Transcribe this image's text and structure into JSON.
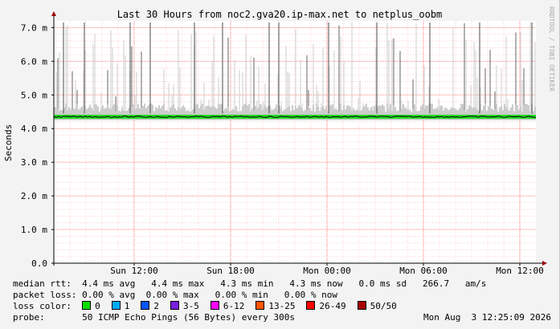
{
  "title": "Last 30 Hours from noc2.gva20.ip-max.net to netplus_oobm",
  "watermark": "RRDTOOL / TOBI OETIKER",
  "colors": {
    "median": "#000000",
    "band": "#22dd22",
    "smoke_dark": "#555555",
    "smoke_light": "#cccccc",
    "grid_major": "#ff8080",
    "grid_minor": "#ffd0d0",
    "axis": "#000000"
  },
  "chart_data": {
    "type": "area",
    "title": "Last 30 Hours from noc2.gva20.ip-max.net to netplus_oobm",
    "ylabel": "Seconds",
    "ylim": [
      0,
      7.2
    ],
    "y_unit": "ms",
    "y_ticks": [
      {
        "value": 0,
        "label": "0.0"
      },
      {
        "value": 1,
        "label": "1.0 m"
      },
      {
        "value": 2,
        "label": "2.0 m"
      },
      {
        "value": 3,
        "label": "3.0 m"
      },
      {
        "value": 4,
        "label": "4.0 m"
      },
      {
        "value": 5,
        "label": "5.0 m"
      },
      {
        "value": 6,
        "label": "6.0 m"
      },
      {
        "value": 7,
        "label": "7.0 m"
      }
    ],
    "x_range_hours": [
      0,
      30
    ],
    "x_ticks": [
      {
        "hour": 5,
        "label": "Sun 12:00"
      },
      {
        "hour": 11,
        "label": "Sun 18:00"
      },
      {
        "hour": 17,
        "label": "Mon 00:00"
      },
      {
        "hour": 23,
        "label": "Mon 06:00"
      },
      {
        "hour": 29,
        "label": "Mon 12:00"
      }
    ],
    "median_ms": 4.35,
    "median_range_ms": [
      4.3,
      4.4
    ],
    "series": [
      {
        "name": "median rtt",
        "avg": "4.4 ms",
        "max": "4.4 ms",
        "min": "4.3 ms",
        "now": "4.3 ms",
        "sd": "0.0 ms",
        "am_s": "266.7"
      },
      {
        "name": "packet loss",
        "avg": "0.00 %",
        "max": "0.00 %",
        "min": "0.00 %",
        "now": "0.00 %"
      }
    ],
    "grid": true
  },
  "stats": {
    "median_label": "median rtt:",
    "median_values": "4.4 ms avg   4.4 ms max   4.3 ms min   4.3 ms now   0.0 ms sd   266.7   am/s",
    "loss_label": "packet loss:",
    "loss_values": "0.00 % avg  0.00 % max   0.00 % min   0.00 % now"
  },
  "loss_color": {
    "label": "loss color:",
    "items": [
      {
        "label": "0",
        "color": "#00dd00"
      },
      {
        "label": "1",
        "color": "#00aaff"
      },
      {
        "label": "2",
        "color": "#0055ff"
      },
      {
        "label": "3-5",
        "color": "#7a1fe0"
      },
      {
        "label": "6-12",
        "color": "#ff00ff"
      },
      {
        "label": "13-25",
        "color": "#ff5500"
      },
      {
        "label": "26-49",
        "color": "#ff0000"
      },
      {
        "label": "50/50",
        "color": "#aa0000"
      }
    ]
  },
  "probe": {
    "label": "probe:",
    "value": "50 ICMP Echo Pings (56 Bytes) every 300s",
    "timestamp": "Mon Aug  3 12:25:09 2026"
  }
}
